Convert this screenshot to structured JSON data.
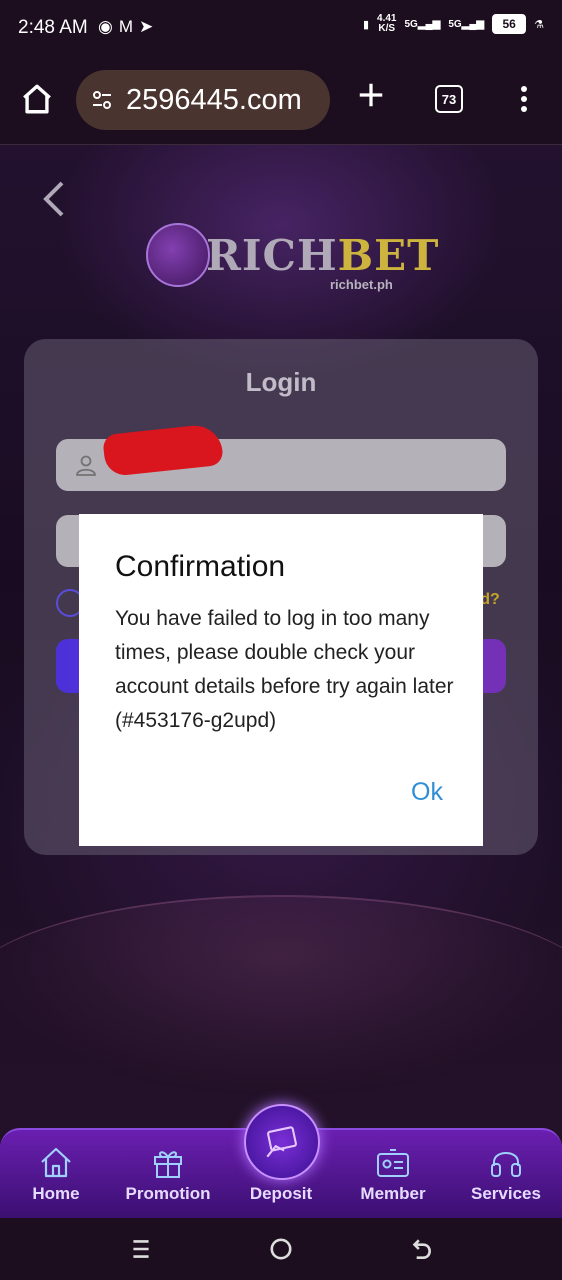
{
  "status_bar": {
    "time": "2:48 AM",
    "speed_value": "4.41",
    "speed_unit": "K/S",
    "net1": "5G",
    "net2": "5G",
    "battery": "56"
  },
  "browser": {
    "url": "2596445.com",
    "tab_count": "73"
  },
  "brand": {
    "name_part1": "RICH",
    "name_part2": "BET",
    "domain": "richbet.ph"
  },
  "login": {
    "title": "Login",
    "forgot_partial": "rd?"
  },
  "dialog": {
    "title": "Confirmation",
    "message": "You have failed to log in too many times, please double check your account details before try again later (#453176-g2upd)",
    "ok_label": "Ok"
  },
  "nav": {
    "items": [
      {
        "label": "Home"
      },
      {
        "label": "Promotion"
      },
      {
        "label": "Deposit"
      },
      {
        "label": "Member"
      },
      {
        "label": "Services"
      }
    ]
  }
}
